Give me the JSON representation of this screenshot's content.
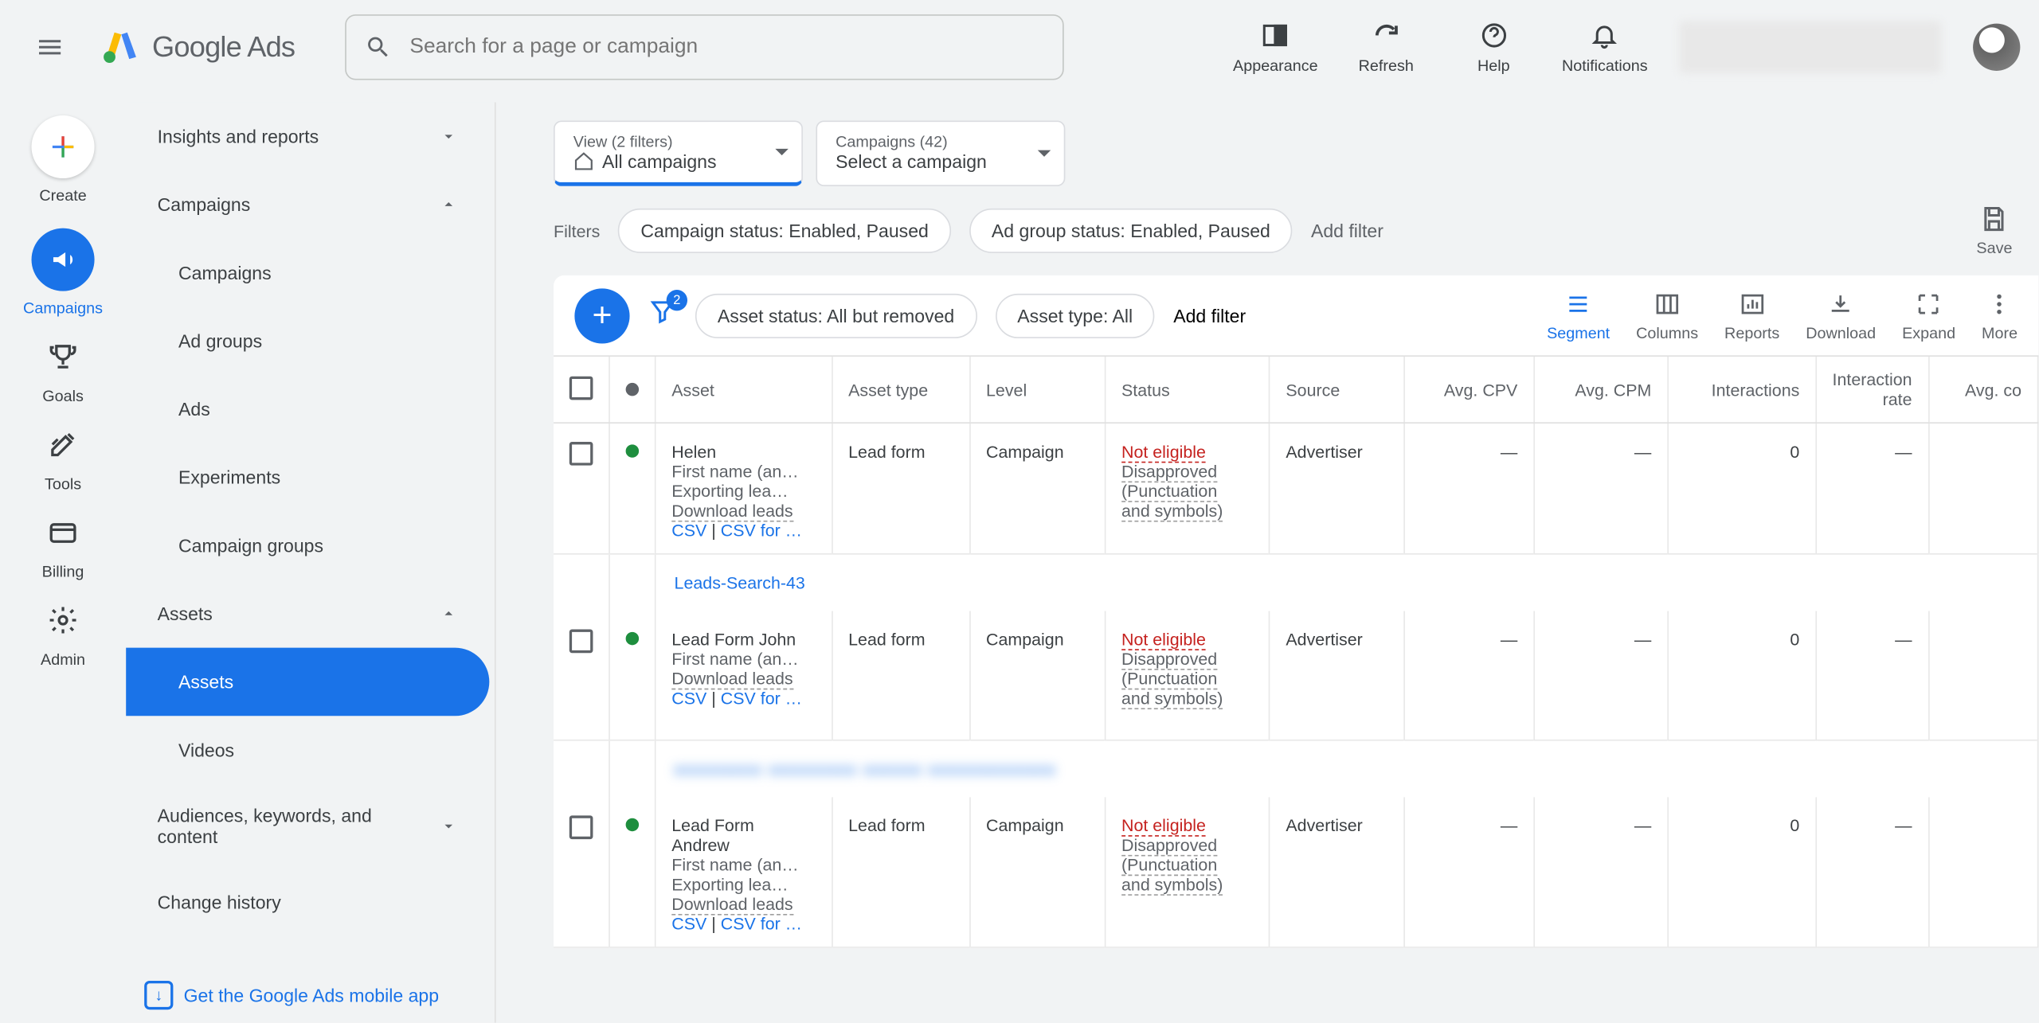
{
  "app": {
    "logo_text": "Google",
    "logo_text2": "Ads"
  },
  "search": {
    "placeholder": "Search for a page or campaign"
  },
  "header_actions": {
    "appearance": "Appearance",
    "refresh": "Refresh",
    "help": "Help",
    "notifications": "Notifications"
  },
  "rail": {
    "create": "Create",
    "campaigns": "Campaigns",
    "goals": "Goals",
    "tools": "Tools",
    "billing": "Billing",
    "admin": "Admin"
  },
  "sidenav": {
    "insights": "Insights and reports",
    "campaigns": "Campaigns",
    "sub": {
      "campaigns": "Campaigns",
      "adgroups": "Ad groups",
      "ads": "Ads",
      "experiments": "Experiments",
      "campaign_groups": "Campaign groups"
    },
    "assets": "Assets",
    "sub2": {
      "assets": "Assets",
      "videos": "Videos"
    },
    "audiences": "Audiences, keywords, and content",
    "change_history": "Change history"
  },
  "mobile_cta": "Get the Google Ads mobile app",
  "selectors": {
    "view_label": "View (2 filters)",
    "view_value": "All campaigns",
    "camp_label": "Campaigns (42)",
    "camp_value": "Select a campaign"
  },
  "filters": {
    "label": "Filters",
    "chip1": "Campaign status: Enabled, Paused",
    "chip2": "Ad group status: Enabled, Paused",
    "add": "Add filter",
    "save": "Save"
  },
  "toolbar": {
    "asset_status": "Asset status: All but removed",
    "asset_type": "Asset type: All",
    "add_filter": "Add filter",
    "filter_badge": "2",
    "actions": {
      "segment": "Segment",
      "columns": "Columns",
      "reports": "Reports",
      "download": "Download",
      "expand": "Expand",
      "more": "More"
    }
  },
  "thead": {
    "asset": "Asset",
    "asset_type": "Asset type",
    "level": "Level",
    "status": "Status",
    "source": "Source",
    "avg_cpv": "Avg. CPV",
    "avg_cpm": "Avg. CPM",
    "interactions": "Interactions",
    "interaction_rate": "Interaction rate",
    "avg_cost": "Avg. co"
  },
  "rows": [
    {
      "title": "Helen",
      "meta": "First name (an…",
      "export": "Exporting lea…",
      "download": "Download leads",
      "csv": "CSV",
      "pipe": " | ",
      "csvfor": "CSV for …",
      "type": "Lead form",
      "level": "Campaign",
      "status1": "Not eligible",
      "status2": "Disapproved",
      "status3": "(Punctuation",
      "status4": "and symbols)",
      "source": "Advertiser",
      "cpv": "—",
      "cpm": "—",
      "int": "0",
      "rate": "—"
    },
    {
      "title": "Lead Form John",
      "meta": "First name (an…",
      "export": "",
      "download": "Download leads",
      "csv": "CSV",
      "pipe": " | ",
      "csvfor": "CSV for …",
      "type": "Lead form",
      "level": "Campaign",
      "status1": "Not eligible",
      "status2": "Disapproved",
      "status3": "(Punctuation",
      "status4": "and symbols)",
      "source": "Advertiser",
      "cpv": "—",
      "cpm": "—",
      "int": "0",
      "rate": "—"
    },
    {
      "title": "Lead Form",
      "title2": "Andrew",
      "meta": "First name (an…",
      "export": "Exporting lea…",
      "download": "Download leads",
      "csv": "CSV",
      "pipe": " | ",
      "csvfor": "CSV for …",
      "type": "Lead form",
      "level": "Campaign",
      "status1": "Not eligible",
      "status2": "Disapproved",
      "status3": "(Punctuation",
      "status4": "and symbols)",
      "source": "Advertiser",
      "cpv": "—",
      "cpm": "—",
      "int": "0",
      "rate": "—"
    }
  ],
  "campaign_links": {
    "first": "Leads-Search-43",
    "second": "xxxxxxxxx xxxxxxxxx xxxxxx xxxxxxxxxxxxx"
  }
}
